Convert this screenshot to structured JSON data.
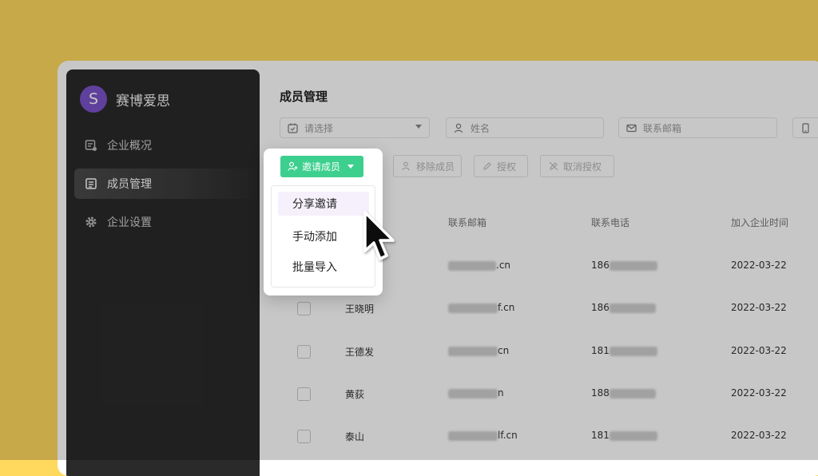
{
  "brand": {
    "avatar_letter": "S",
    "name": "赛博爱思",
    "avatar_color": "#7b52c9"
  },
  "sidebar": {
    "items": [
      {
        "label": "企业概况",
        "icon": "dashboard-icon",
        "active": false
      },
      {
        "label": "成员管理",
        "icon": "member-list-icon",
        "active": true
      },
      {
        "label": "企业设置",
        "icon": "gear-icon",
        "active": false
      }
    ]
  },
  "main": {
    "title": "成员管理",
    "filters": {
      "select_placeholder": "请选择",
      "name_placeholder": "姓名",
      "email_placeholder": "联系邮箱"
    },
    "toolbar": {
      "invite_label": "邀请成员",
      "remove_label": "移除成员",
      "grant_label": "授权",
      "revoke_label": "取消授权"
    },
    "dropdown": {
      "items": [
        "分享邀请",
        "手动添加",
        "批量导入"
      ]
    },
    "table": {
      "columns": [
        "联系邮箱",
        "联系电话",
        "加入企业时间"
      ],
      "rows": [
        {
          "name": "",
          "email_suffix": ".cn",
          "phone_prefix": "186",
          "joined": "2022-03-22"
        },
        {
          "name": "王晓明",
          "email_suffix": "f.cn",
          "phone_prefix": "186",
          "joined": "2022-03-22"
        },
        {
          "name": "王德发",
          "email_suffix": "cn",
          "phone_prefix": "181",
          "joined": "2022-03-22"
        },
        {
          "name": "黄荻",
          "email_suffix": "n",
          "phone_prefix": "188",
          "joined": "2022-03-22"
        },
        {
          "name": "泰山",
          "email_suffix": "lf.cn",
          "phone_prefix": "181",
          "joined": "2022-03-22"
        }
      ]
    }
  },
  "colors": {
    "accent": "#3ccf8e",
    "background": "#ffd95e",
    "sidebar": "#2a2a2a"
  }
}
